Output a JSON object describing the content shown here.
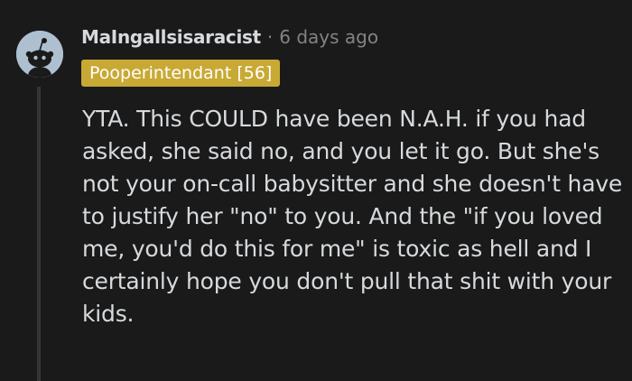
{
  "comment": {
    "username": "MaIngallsisaracist",
    "separator": "·",
    "timestamp": "6 days ago",
    "flair": "Pooperintendant [56]",
    "body": "YTA. This COULD have been N.A.H. if you had asked, she said no, and you let it go. But she's not your on-call babysitter and she doesn't have to justify her \"no\" to you. And the \"if you loved me, you'd do this for me\" is toxic as hell and I certainly hope you don't pull that shit with your kids."
  },
  "colors": {
    "background": "#1a1a1b",
    "text": "#d7dadc",
    "muted": "#818384",
    "flair_bg": "#c8a934",
    "avatar_bg": "#aebfd0",
    "thread_line": "#343536"
  },
  "icons": {
    "avatar": "snoo-avatar-icon"
  }
}
